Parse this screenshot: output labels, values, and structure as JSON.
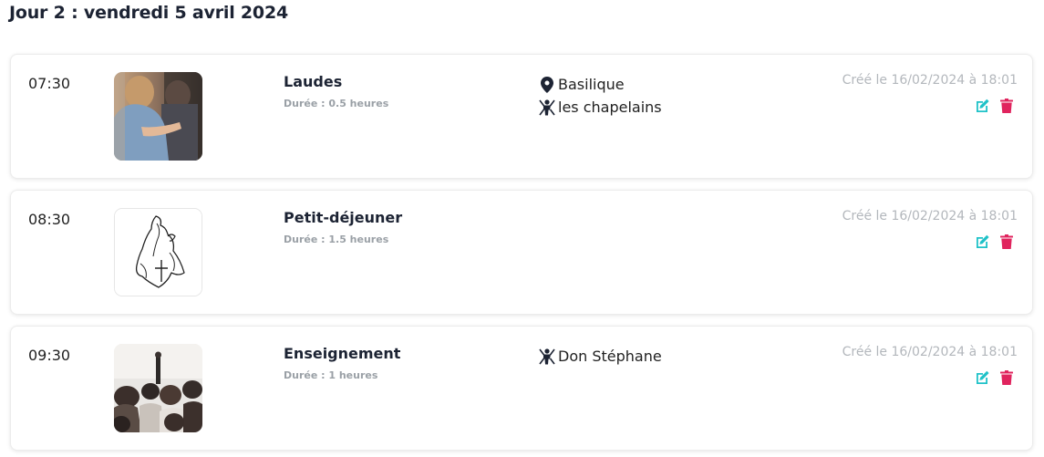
{
  "day": {
    "title": "Jour 2 : vendredi 5 avril 2024"
  },
  "colors": {
    "edit": "#1fc2c8",
    "delete": "#e0245e",
    "muted": "#b3b7bc"
  },
  "events": [
    {
      "time": "07:30",
      "title": "Laudes",
      "duration": "Durée : 0.5 heures",
      "image": "photo-people-praying",
      "location": "Basilique",
      "presenter": "les chapelains",
      "created": "Créé le 16/02/2024 à 18:01"
    },
    {
      "time": "08:30",
      "title": "Petit-déjeuner",
      "duration": "Durée : 1.5 heures",
      "image": "logo-sketch-cross",
      "created": "Créé le 16/02/2024 à 18:01"
    },
    {
      "time": "09:30",
      "title": "Enseignement",
      "duration": "Durée : 1 heures",
      "image": "photo-lecture-audience",
      "presenter": "Don Stéphane",
      "created": "Créé le 16/02/2024 à 18:01"
    }
  ],
  "icons": {
    "location": "map-marker-icon",
    "presenter": "chalkboard-teacher-icon",
    "edit": "edit-icon",
    "delete": "trash-icon"
  }
}
